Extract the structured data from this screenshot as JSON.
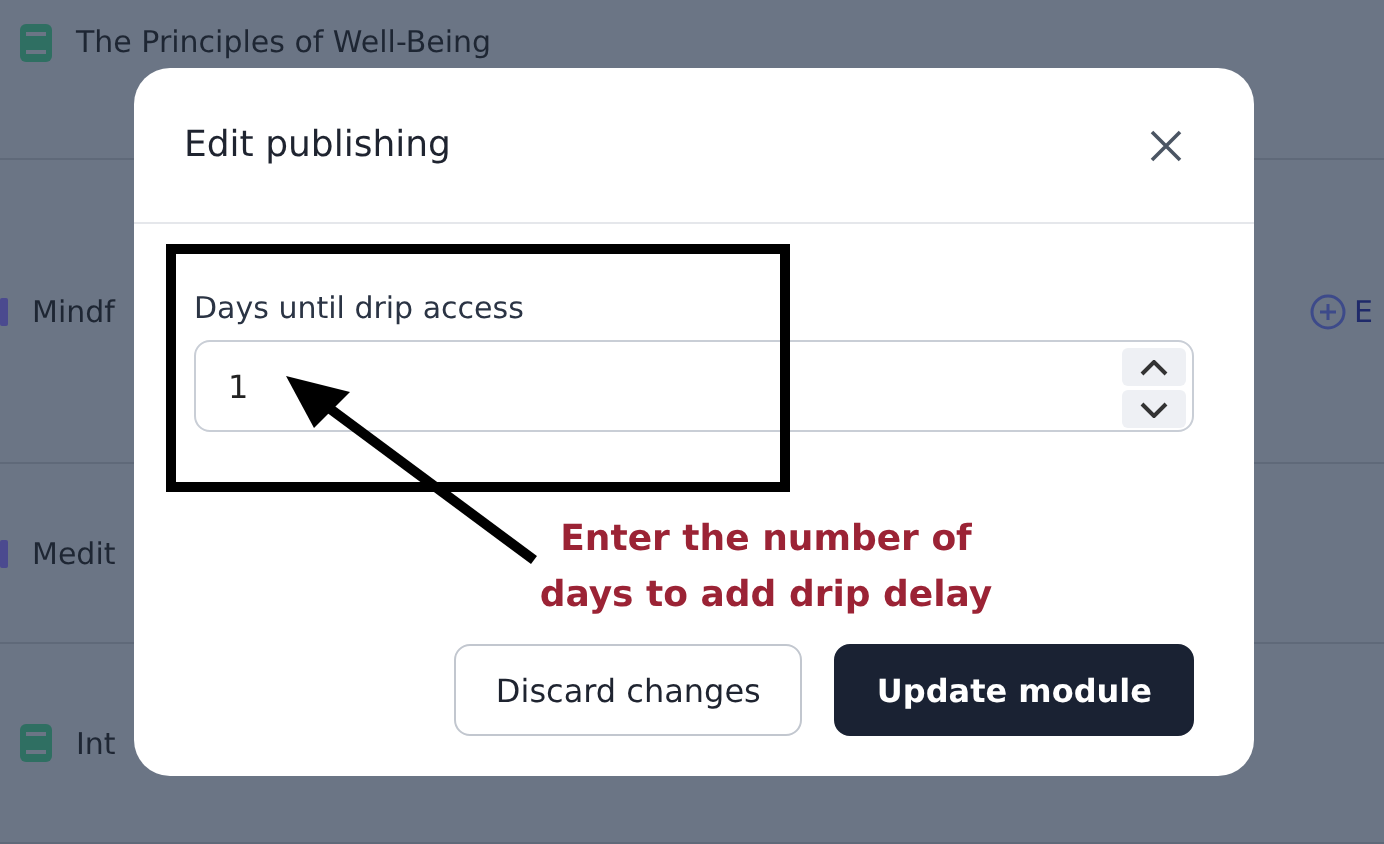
{
  "background_list": {
    "rows": [
      {
        "kind": "book",
        "title": "The Principles of Well-Being"
      },
      {
        "kind": "section",
        "title": "Mindf",
        "action": "E"
      },
      {
        "kind": "section",
        "title": "Medit"
      },
      {
        "kind": "book",
        "title": "Int"
      }
    ]
  },
  "dialog": {
    "title": "Edit publishing",
    "field": {
      "label": "Days until drip access",
      "value": "1"
    },
    "buttons": [
      {
        "label": "Discard changes",
        "kind": "secondary"
      },
      {
        "label": "Update module",
        "kind": "primary"
      }
    ]
  },
  "annotation": {
    "text": "Enter the number of days to add drip delay"
  }
}
